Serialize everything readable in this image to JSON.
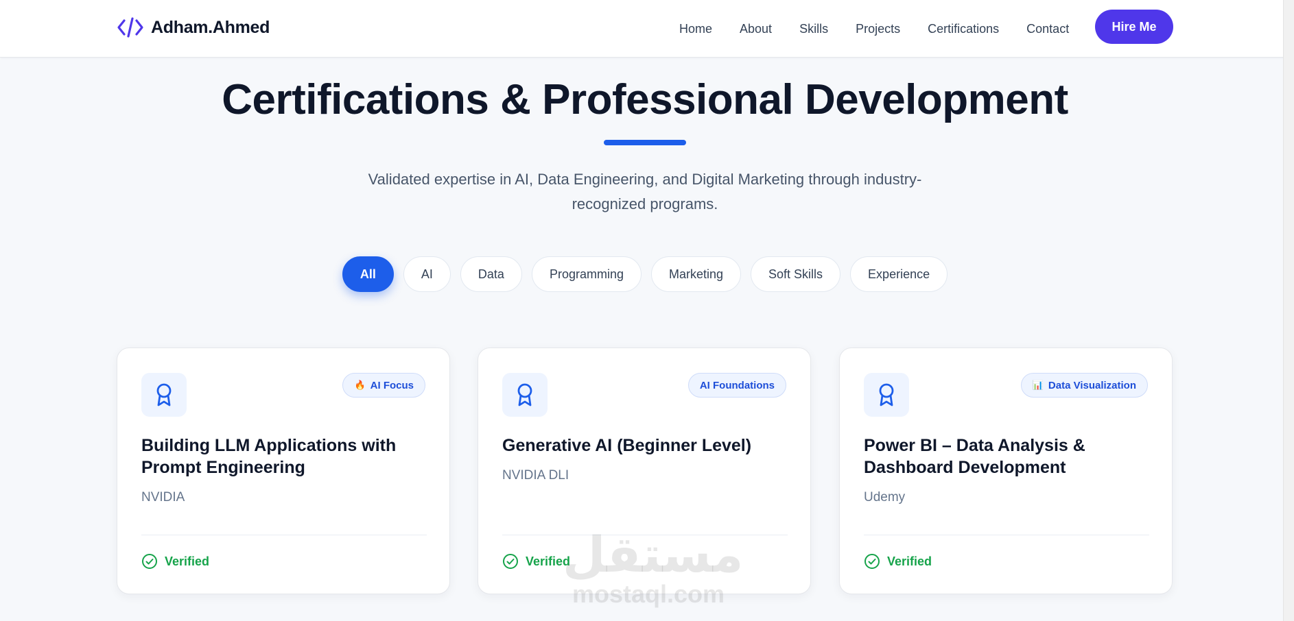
{
  "header": {
    "brand_name": "Adham.Ahmed",
    "nav": [
      "Home",
      "About",
      "Skills",
      "Projects",
      "Certifications",
      "Contact"
    ],
    "cta_label": "Hire Me"
  },
  "hero": {
    "title": "Certifications & Professional Development",
    "subtitle": "Validated expertise in AI, Data Engineering, and Digital Marketing through industry-recognized programs."
  },
  "filters": [
    {
      "label": "All",
      "active": true
    },
    {
      "label": "AI",
      "active": false
    },
    {
      "label": "Data",
      "active": false
    },
    {
      "label": "Programming",
      "active": false
    },
    {
      "label": "Marketing",
      "active": false
    },
    {
      "label": "Soft Skills",
      "active": false
    },
    {
      "label": "Experience",
      "active": false
    }
  ],
  "cards": [
    {
      "badge_emoji": "🔥",
      "badge": "AI Focus",
      "title": "Building LLM Applications with Prompt Engineering",
      "issuer": "NVIDIA",
      "status": "Verified"
    },
    {
      "badge_emoji": "",
      "badge": "AI Foundations",
      "title": "Generative AI (Beginner Level)",
      "issuer": "NVIDIA DLI",
      "status": "Verified"
    },
    {
      "badge_emoji": "📊",
      "badge": "Data Visualization",
      "title": "Power BI – Data Analysis & Dashboard Development",
      "issuer": "Udemy",
      "status": "Verified"
    }
  ],
  "watermark": {
    "arabic": "مستقل",
    "latin": "mostaql.com"
  },
  "colors": {
    "primary": "#1d5eea",
    "cta": "#4f37ea",
    "verified": "#16a34a"
  }
}
